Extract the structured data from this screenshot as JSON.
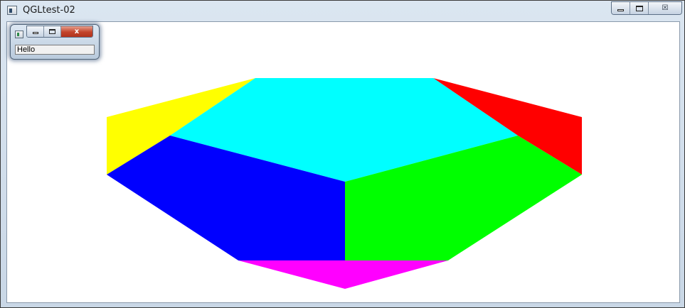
{
  "window": {
    "title": "QGLtest-02",
    "icon": "app-window-icon",
    "controls": {
      "minimize_icon": "minimize-icon",
      "maximize_icon": "maximize-icon",
      "close_glyph": "☒"
    }
  },
  "viewport": {
    "description_icon": "opengl-octagonal-prism",
    "face_colors": {
      "top": "#00ffff",
      "front_left": "#0000ff",
      "front_right": "#00ff00",
      "left": "#ffff00",
      "right": "#ff0000",
      "bottom": "#ff00ff"
    }
  },
  "child_window": {
    "icon": "app-window-icon",
    "close_glyph": "x",
    "text_field_value": "Hello"
  }
}
